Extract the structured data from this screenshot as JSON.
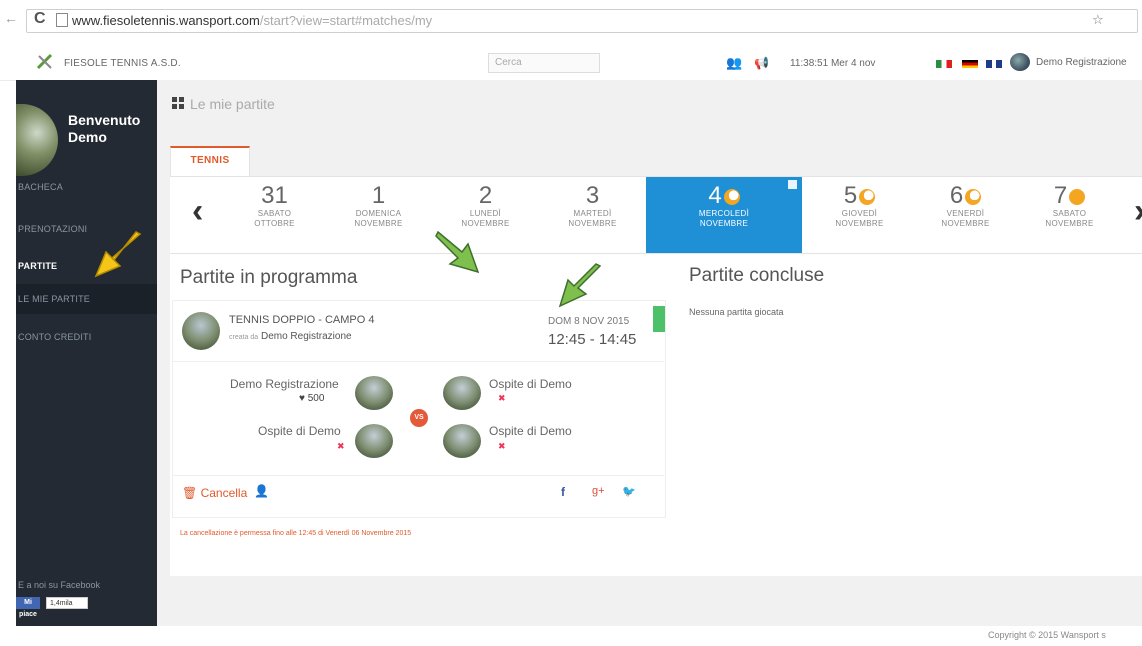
{
  "browser": {
    "url_host": "www.fiesoletennis.wansport.com",
    "url_path": "/start?view=start#matches/my"
  },
  "topbar": {
    "club_name": "FIESOLE TENNIS A.S.D.",
    "search_placeholder": "Cerca",
    "datetime": "11:38:51 Mer 4 nov",
    "user_name": "Demo Registrazione"
  },
  "sidebar": {
    "welcome_line1": "Benvenuto",
    "welcome_line2": "Demo",
    "items": [
      {
        "label": "BACHECA"
      },
      {
        "label": "PRENOTAZIONI"
      },
      {
        "label": "PARTITE"
      },
      {
        "label": "LE MIE PARTITE"
      },
      {
        "label": "CONTO CREDITI"
      }
    ],
    "facebook_text": "E a noi su Facebook",
    "facebook_button": "Mi piace",
    "facebook_count": "1,4mila"
  },
  "main": {
    "breadcrumb": "Le mie partite",
    "tab": "TENNIS",
    "days": [
      {
        "num": "31",
        "dname": "SABATO",
        "month": "OTTOBRE"
      },
      {
        "num": "1",
        "dname": "DOMENICA",
        "month": "NOVEMBRE"
      },
      {
        "num": "2",
        "dname": "LUNEDÌ",
        "month": "NOVEMBRE"
      },
      {
        "num": "3",
        "dname": "MARTEDÌ",
        "month": "NOVEMBRE"
      },
      {
        "num": "4",
        "dname": "MERCOLEDÌ",
        "month": "NOVEMBRE"
      },
      {
        "num": "5",
        "dname": "GIOVEDÌ",
        "month": "NOVEMBRE"
      },
      {
        "num": "6",
        "dname": "VENERDÌ",
        "month": "NOVEMBRE"
      },
      {
        "num": "7",
        "dname": "SABATO",
        "month": "NOVEMBRE"
      }
    ],
    "scheduled_title": "Partite in programma",
    "finished_title": "Partite concluse",
    "no_matches": "Nessuna partita giocata",
    "match": {
      "court": "TENNIS DOPPIO - CAMPO 4",
      "created_by_label": "creata da",
      "created_by": "Demo Registrazione",
      "date": "DOM 8 NOV 2015",
      "time": "12:45 - 14:45",
      "player1": "Demo Registrazione",
      "player1_credits": "500",
      "player2": "Ospite di Demo",
      "player3": "Ospite di Demo",
      "player4": "Ospite di Demo",
      "vs": "VS",
      "cancel_label": "Cancella"
    },
    "cancel_note": "La cancellazione è permessa fino alle 12:45 di Venerdì 06 Novembre 2015"
  },
  "footer": {
    "copyright": "Copyright © 2015 Wansport s"
  },
  "colors": {
    "sidebar_bg": "#232a33",
    "accent_orange": "#e05a2b",
    "active_day_blue": "#1f8fd6",
    "status_green": "#4cc16a",
    "annotation_arrow_yellow": "#f5c518",
    "annotation_arrow_green": "#7fbf4d"
  }
}
